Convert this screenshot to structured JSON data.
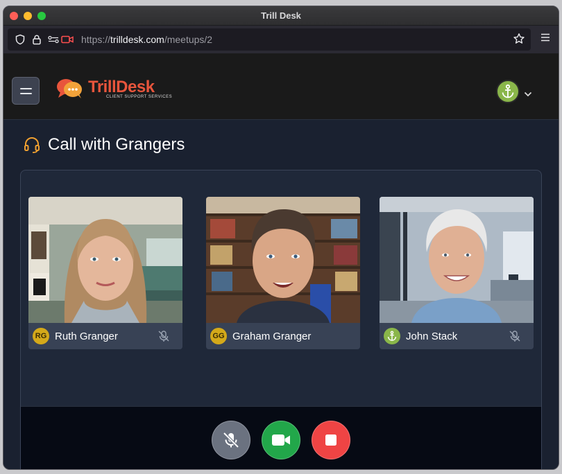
{
  "window": {
    "title": "Trill Desk"
  },
  "browser": {
    "url_prefix": "https://",
    "url_host": "trilldesk.com",
    "url_path": "/meetups/2"
  },
  "app": {
    "logo_name": "TrillDesk",
    "logo_tagline": "CLIENT SUPPORT SERVICES",
    "user_avatar_icon": "anchor-icon"
  },
  "page": {
    "title": "Call with Grangers"
  },
  "participants": [
    {
      "initials": "RG",
      "name": "Ruth Granger",
      "muted": true
    },
    {
      "initials": "GG",
      "name": "Graham Granger",
      "muted": false
    },
    {
      "initials": "",
      "name": "John Stack",
      "muted": true,
      "avatar_icon": "anchor-icon"
    }
  ],
  "controls": {
    "mic": {
      "icon": "mic-off-icon",
      "color": "#6b7280"
    },
    "camera": {
      "icon": "video-camera-icon",
      "color": "#22a74a"
    },
    "end": {
      "icon": "stop-icon",
      "color": "#ef4444"
    }
  },
  "colors": {
    "brand": "#e8553c",
    "accent_gold": "#d4a91a",
    "accent_green": "#8ab64a"
  }
}
